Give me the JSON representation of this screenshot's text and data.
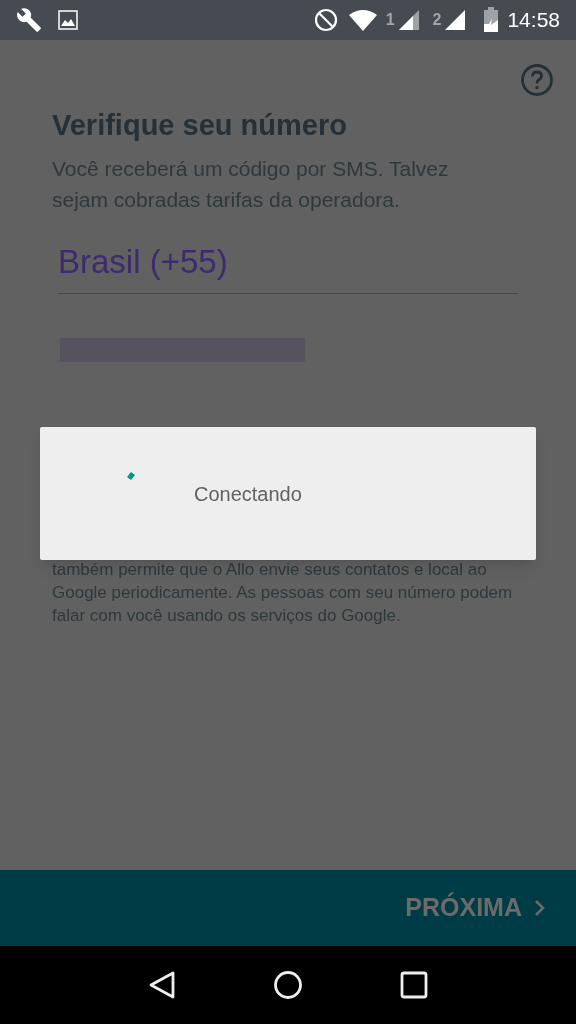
{
  "status_bar": {
    "sim_labels": [
      "1",
      "2"
    ],
    "time": "14:58"
  },
  "page": {
    "title": "Verifique seu número",
    "description": "Você receberá um código por SMS. Talvez sejam cobradas tarifas da operadora.",
    "country_field": {
      "value": "Brasil (+55)"
    },
    "notice": "também permite que o Allo envie seus contatos e local ao Google periodicamente. As pessoas com seu número podem falar com você usando os serviços do Google."
  },
  "dialog": {
    "message": "Conectando"
  },
  "next_button": {
    "label": "PRÓXIMA",
    "disabled": true
  }
}
